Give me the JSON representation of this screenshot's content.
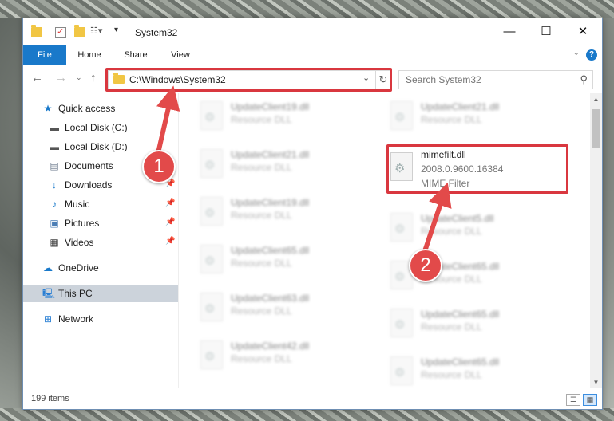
{
  "window": {
    "title": "System32",
    "minimize_icon": "minimize-icon",
    "maximize_icon": "maximize-icon",
    "close_icon": "close-icon"
  },
  "ribbon": {
    "tabs": [
      "File",
      "Home",
      "Share",
      "View"
    ],
    "help_glyph": "?"
  },
  "address": {
    "path": "C:\\Windows\\System32",
    "search_placeholder": "Search System32"
  },
  "sidebar": {
    "items": [
      {
        "label": "Quick access",
        "icon": "star-icon"
      },
      {
        "label": "Local Disk (C:)",
        "icon": "drive-icon"
      },
      {
        "label": "Local Disk (D:)",
        "icon": "drive-icon"
      },
      {
        "label": "Documents",
        "icon": "documents-icon"
      },
      {
        "label": "Downloads",
        "icon": "download-icon"
      },
      {
        "label": "Music",
        "icon": "music-icon"
      },
      {
        "label": "Pictures",
        "icon": "pictures-icon"
      },
      {
        "label": "Videos",
        "icon": "videos-icon"
      },
      {
        "label": "OneDrive",
        "icon": "cloud-icon"
      },
      {
        "label": "This PC",
        "icon": "computer-icon"
      },
      {
        "label": "Network",
        "icon": "network-icon"
      }
    ]
  },
  "files": {
    "left": [
      {
        "name": "UpdateClient19.dll",
        "type": "Resource DLL"
      },
      {
        "name": "UpdateClient21.dll",
        "type": "Resource DLL"
      },
      {
        "name": "UpdateClient19.dll",
        "type": "Resource DLL"
      },
      {
        "name": "UpdateClient65.dll",
        "type": "Resource DLL"
      },
      {
        "name": "UpdateClient63.dll",
        "type": "Resource DLL"
      },
      {
        "name": "UpdateClient42.dll",
        "type": "Resource DLL"
      }
    ],
    "right": [
      {
        "name": "UpdateClient21.dll",
        "type": "Resource DLL"
      },
      {
        "name": "UpdateClient5.dll",
        "type": "Resource DLL"
      },
      {
        "name": "UpdateClient65.dll",
        "type": "Resource DLL"
      },
      {
        "name": "UpdateClient65.dll",
        "type": "Resource DLL"
      },
      {
        "name": "UpdateClient65.dll",
        "type": "Resource DLL"
      }
    ],
    "highlighted": {
      "name": "mimefilt.dll",
      "version": "2008.0.9600.16384",
      "description": "MIME Filter"
    }
  },
  "status": {
    "item_count": "199 items"
  },
  "callouts": [
    "1",
    "2"
  ],
  "colors": {
    "accent": "#1979ca",
    "highlight": "#d9373f",
    "callout": "#e24a4a"
  }
}
